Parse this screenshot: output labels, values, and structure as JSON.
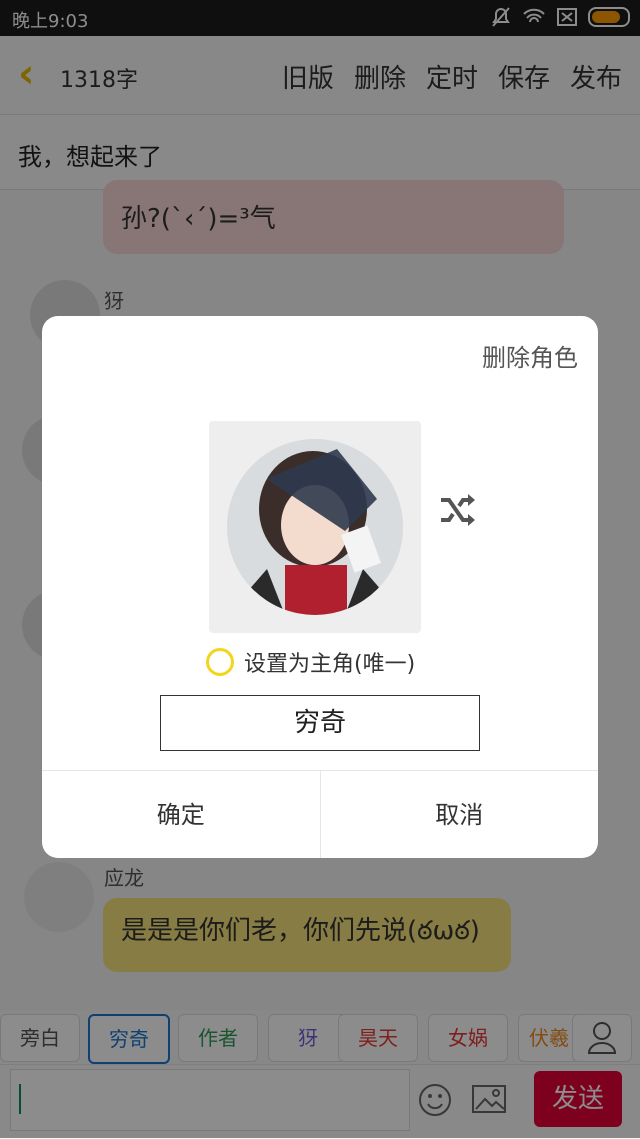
{
  "status_bar": {
    "time": "晚上9:03"
  },
  "header": {
    "word_count": "1318字",
    "actions": [
      "旧版",
      "删除",
      "定时",
      "保存",
      "发布"
    ]
  },
  "chapter_title": "我，想起来了",
  "chat": {
    "partial_message": "孙?(`‹´)=³气",
    "name_1": "犽",
    "name_2": "应龙",
    "message_2": "是是是你们老，你们先说(ఠωఠ)"
  },
  "roles": [
    "旁白",
    "穷奇",
    "作者",
    "犽",
    "昊天",
    "女娲",
    "伏羲"
  ],
  "send_label": "发送",
  "dialog": {
    "delete_role": "删除角色",
    "set_main_role": "设置为主角(唯一)",
    "role_name": "穷奇",
    "confirm": "确定",
    "cancel": "取消"
  },
  "colors": {
    "accent_yellow": "#e7b800",
    "send_red": "#e60039"
  }
}
